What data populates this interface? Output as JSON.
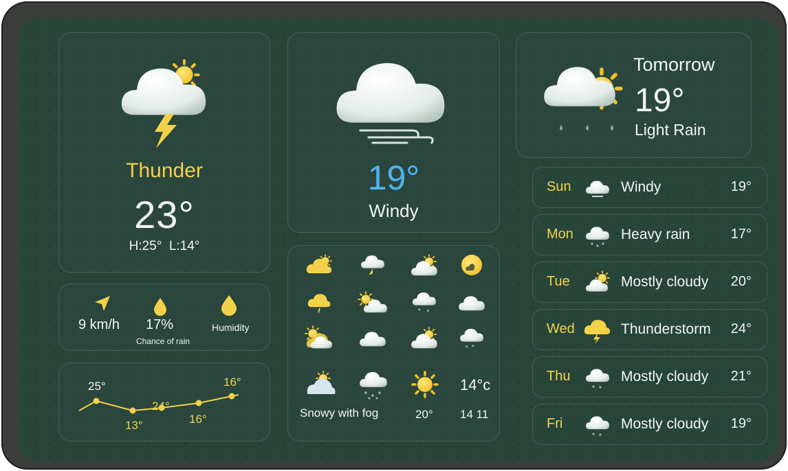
{
  "current": {
    "condition": "Thunder",
    "temp": "23°",
    "high": "H:25°",
    "low": "L:14°"
  },
  "center": {
    "temp": "19°",
    "condition": "Windy"
  },
  "tomorrow": {
    "label": "Tomorrow",
    "temp": "19°",
    "condition": "Light Rain"
  },
  "details": {
    "wind": "9 km/h",
    "rain_pct": "17%",
    "rain_label": "Chance of rain",
    "humidity_label": "Humidity"
  },
  "trend": {
    "labels": [
      "25°",
      "24°",
      "16°",
      "13°",
      "16°"
    ]
  },
  "grid": {
    "caption": "Snowy with fog",
    "temp_a": "20°",
    "temp_b": "14°c",
    "temp_c": "14 11"
  },
  "forecast": [
    {
      "day": "Sun",
      "icon": "windy-cloud-icon",
      "condition": "Windy",
      "temp": "19°"
    },
    {
      "day": "Mon",
      "icon": "heavy-rain-icon",
      "condition": "Heavy rain",
      "temp": "17°"
    },
    {
      "day": "Tue",
      "icon": "partly-sunny-icon",
      "condition": "Mostly cloudy",
      "temp": "20°"
    },
    {
      "day": "Wed",
      "icon": "thunderstorm-icon",
      "condition": "Thunderstorm",
      "temp": "24°"
    },
    {
      "day": "Thu",
      "icon": "cloud-rain-icon",
      "condition": "Mostly cloudy",
      "temp": "21°"
    },
    {
      "day": "Fri",
      "icon": "cloud-rain-icon",
      "condition": "Mostly cloudy",
      "temp": "19°"
    }
  ],
  "colors": {
    "background": "#28453a",
    "accent": "#f1d24a",
    "temp_blue": "#4fb3f2"
  }
}
